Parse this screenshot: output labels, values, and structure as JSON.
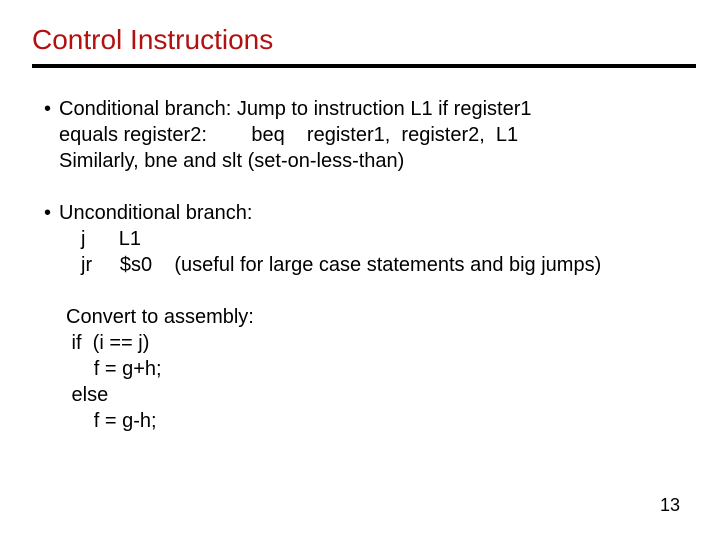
{
  "title": "Control Instructions",
  "bullets": [
    {
      "line1": "Conditional branch: Jump to instruction L1 if register1",
      "line2": "equals register2:        beq    register1,  register2,  L1",
      "line3": "Similarly,   bne  and  slt (set-on-less-than)"
    },
    {
      "line1": "Unconditional branch:",
      "row1": "j      L1",
      "row2": "jr     $s0    (useful for large case statements and big jumps)"
    }
  ],
  "code": {
    "l1": "Convert to assembly:",
    "l2": " if  (i == j)",
    "l3": "     f = g+h;",
    "l4": " else",
    "l5": "     f = g-h;"
  },
  "page_number": "13"
}
